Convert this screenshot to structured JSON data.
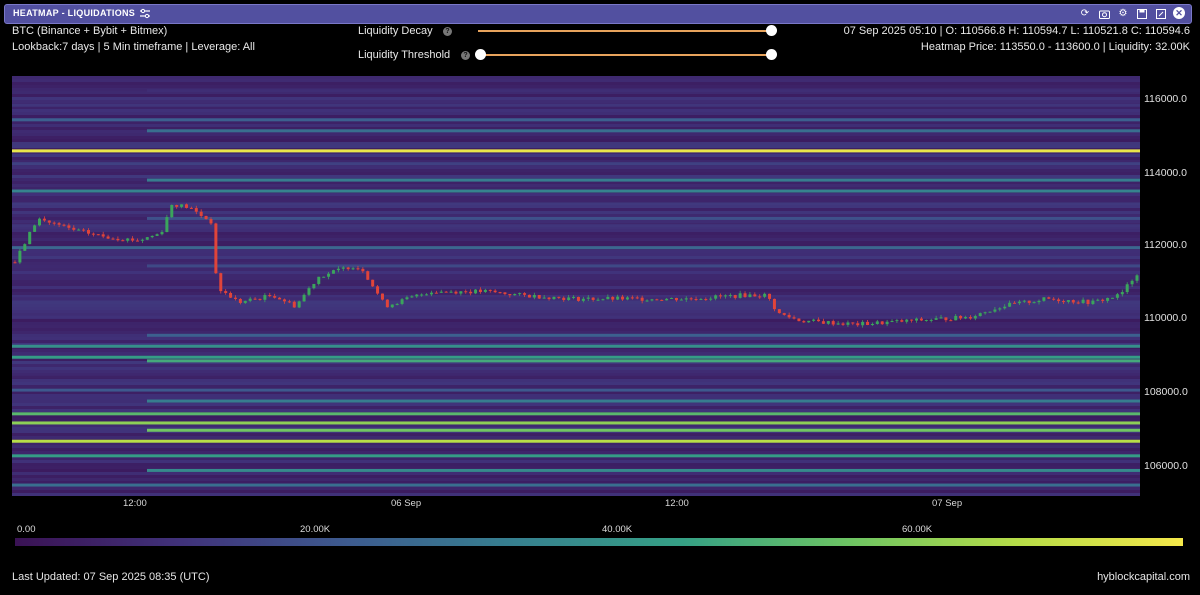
{
  "window": {
    "title": "HEATMAP - LIQUIDATIONS",
    "icons": [
      "filter-icon",
      "refresh-icon",
      "camera-icon",
      "gear-icon",
      "save-icon",
      "expand-icon",
      "close-icon"
    ]
  },
  "info": {
    "exchanges": "BTC (Binance + Bybit + Bitmex)",
    "lookback": "Lookback:7 days | 5 Min timeframe | Leverage: All",
    "ohlc": "07 Sep 2025 05:10 | O: 110566.8 H: 110594.7 L: 110521.8 C: 110594.6",
    "heatmap_price": "Heatmap Price: 113550.0 - 113600.0 | Liquidity: 32.00K"
  },
  "controls": {
    "decay_label": "Liquidity Decay",
    "threshold_label": "Liquidity Threshold",
    "decay_value": 1.0,
    "threshold_range": [
      0.0,
      1.0
    ]
  },
  "chart_data": {
    "type": "heatmap",
    "title": "HEATMAP - LIQUIDATIONS",
    "y_ticks": [
      "116000.0",
      "114000.0",
      "112000.0",
      "110000.0",
      "108000.0",
      "106000.0"
    ],
    "y_tick_values": [
      116000,
      114000,
      112000,
      110000,
      108000,
      106000
    ],
    "ylim": [
      105200,
      116700
    ],
    "x_ticks": [
      "12:00",
      "06 Sep",
      "12:00",
      "07 Sep"
    ],
    "x_tick_values": [
      0.109,
      0.35,
      0.59,
      0.83
    ],
    "colorbar_ticks": [
      "0.00",
      "20.00K",
      "40.00K",
      "60.00K"
    ],
    "colorbar_tick_values": [
      0,
      20000,
      40000,
      60000
    ],
    "colorbar_max": 72000,
    "liquidity_bands": [
      {
        "price": 116300,
        "value": 9000
      },
      {
        "price": 115900,
        "value": 11000
      },
      {
        "price": 115500,
        "value": 22000
      },
      {
        "price": 115200,
        "value": 26000
      },
      {
        "price": 114650,
        "value": 70000
      },
      {
        "price": 114300,
        "value": 14000
      },
      {
        "price": 113850,
        "value": 30000
      },
      {
        "price": 113550,
        "value": 32000
      },
      {
        "price": 113200,
        "value": 12000
      },
      {
        "price": 112800,
        "value": 18000
      },
      {
        "price": 112600,
        "value": 11000
      },
      {
        "price": 112000,
        "value": 24000
      },
      {
        "price": 111500,
        "value": 16000
      },
      {
        "price": 110600,
        "value": 8000
      },
      {
        "price": 110100,
        "value": 10000
      },
      {
        "price": 109600,
        "value": 22000
      },
      {
        "price": 109300,
        "value": 36000
      },
      {
        "price": 109000,
        "value": 40000
      },
      {
        "price": 108900,
        "value": 44000
      },
      {
        "price": 108450,
        "value": 5000
      },
      {
        "price": 108100,
        "value": 20000
      },
      {
        "price": 107800,
        "value": 30000
      },
      {
        "price": 107450,
        "value": 48000
      },
      {
        "price": 107200,
        "value": 56000
      },
      {
        "price": 107000,
        "value": 52000
      },
      {
        "price": 106700,
        "value": 62000
      },
      {
        "price": 106300,
        "value": 40000
      },
      {
        "price": 105900,
        "value": 34000
      },
      {
        "price": 105500,
        "value": 26000
      }
    ],
    "price_series": {
      "x": [
        0.0,
        0.02,
        0.05,
        0.08,
        0.11,
        0.13,
        0.14,
        0.155,
        0.165,
        0.175,
        0.18,
        0.2,
        0.23,
        0.25,
        0.27,
        0.3,
        0.31,
        0.33,
        0.37,
        0.42,
        0.45,
        0.5,
        0.55,
        0.6,
        0.65,
        0.67,
        0.68,
        0.7,
        0.75,
        0.8,
        0.85,
        0.88,
        0.92,
        0.96,
        0.985,
        1.0
      ],
      "y": [
        111600,
        112800,
        112500,
        112300,
        112200,
        112400,
        113200,
        113100,
        112900,
        112700,
        110900,
        110500,
        110700,
        110400,
        111200,
        111500,
        111400,
        110400,
        110800,
        110800,
        110700,
        110600,
        110600,
        110600,
        110700,
        110700,
        110200,
        110000,
        109900,
        110000,
        110100,
        110400,
        110600,
        110500,
        110700,
        111300
      ]
    }
  },
  "axis": {
    "y": [
      "116000.0",
      "114000.0",
      "112000.0",
      "110000.0",
      "108000.0",
      "106000.0"
    ],
    "x": [
      "12:00",
      "06 Sep",
      "12:00",
      "07 Sep"
    ],
    "colorbar": [
      "0.00",
      "20.00K",
      "40.00K",
      "60.00K"
    ]
  },
  "footer": {
    "last_updated": "Last Updated: 07 Sep 2025 08:35 (UTC)",
    "site": "hyblockcapital.com"
  },
  "colors": {
    "titlebar": "#5250a0",
    "background": "#000000",
    "up_candle": "#3ba55c",
    "down_candle": "#e0443a",
    "slider": "#e7a35c"
  }
}
